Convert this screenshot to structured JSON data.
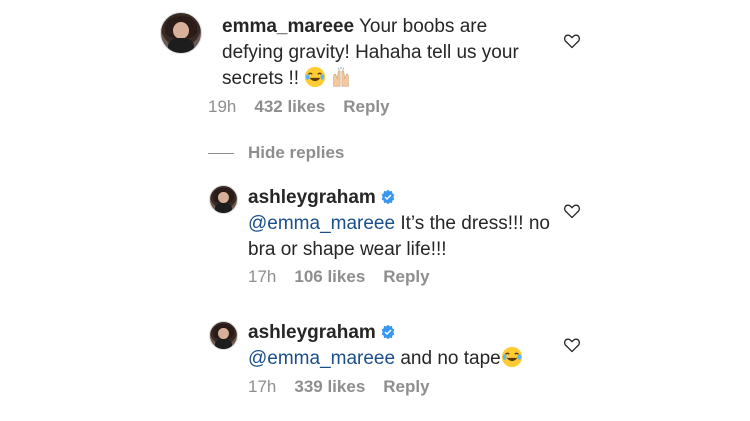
{
  "comments": [
    {
      "username": "emma_mareee",
      "text": " Your boobs are defying gravity! Hahaha tell us your secrets !! ",
      "time": "19h",
      "likes": "432 likes",
      "reply": "Reply",
      "emojis": [
        "laughing-tears-emoji",
        "raised-hands-emoji"
      ]
    },
    {
      "username": "ashleygraham",
      "mention": "@emma_mareee",
      "text": " It’s the dress!!! no bra or shape wear life!!!",
      "time": "17h",
      "likes": "106 likes",
      "reply": "Reply",
      "verified": true
    },
    {
      "username": "ashleygraham",
      "mention": "@emma_mareee",
      "text": " and no tape",
      "time": "17h",
      "likes": "339 likes",
      "reply": "Reply",
      "verified": true,
      "emojis": [
        "laughing-tears-emoji"
      ]
    }
  ],
  "hide_replies_label": "Hide replies",
  "colors": {
    "text": "#262626",
    "meta": "#8e8e8e",
    "mention": "#1a4f8b",
    "verified": "#3897f0"
  }
}
